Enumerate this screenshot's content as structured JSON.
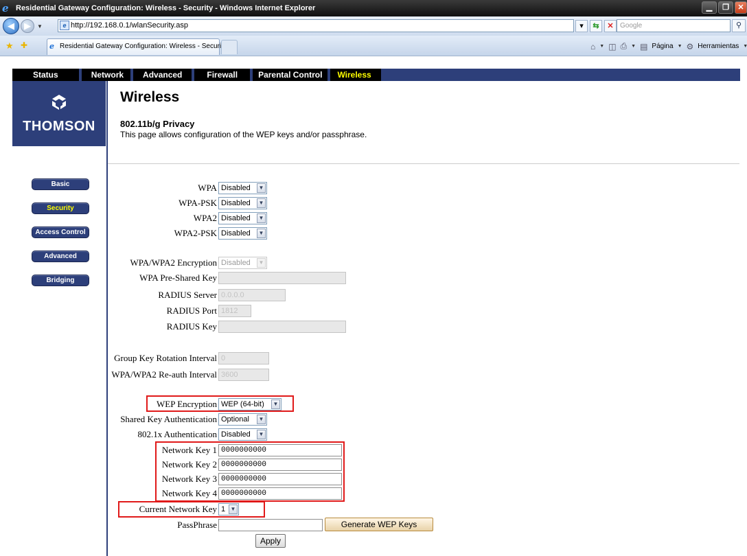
{
  "window": {
    "title": "Residential Gateway Configuration: Wireless - Security - Windows Internet Explorer"
  },
  "browser": {
    "url": "http://192.168.0.1/wlanSecurity.asp",
    "search_placeholder": "Google",
    "tab_title": "Residential Gateway Configuration: Wireless - Security",
    "page_menu": "Página",
    "tools_menu": "Herramientas"
  },
  "topnav": [
    "Status",
    "Network",
    "Advanced",
    "Firewall",
    "Parental Control",
    "Wireless"
  ],
  "logo_text": "THOMSON",
  "sidebar": [
    "Basic",
    "Security",
    "Access Control",
    "Advanced",
    "Bridging"
  ],
  "page": {
    "title": "Wireless",
    "subtitle": "802.11b/g Privacy",
    "description": "This page allows configuration of the WEP keys and/or passphrase."
  },
  "form": {
    "wpa": {
      "label": "WPA",
      "value": "Disabled"
    },
    "wpa_psk": {
      "label": "WPA-PSK",
      "value": "Disabled"
    },
    "wpa2": {
      "label": "WPA2",
      "value": "Disabled"
    },
    "wpa2_psk": {
      "label": "WPA2-PSK",
      "value": "Disabled"
    },
    "encryption": {
      "label": "WPA/WPA2 Encryption",
      "value": "Disabled"
    },
    "preshared_key": {
      "label": "WPA Pre-Shared Key",
      "value": ""
    },
    "radius_server": {
      "label": "RADIUS Server",
      "value": "0.0.0.0"
    },
    "radius_port": {
      "label": "RADIUS Port",
      "value": "1812"
    },
    "radius_key": {
      "label": "RADIUS Key",
      "value": ""
    },
    "group_key_interval": {
      "label": "Group Key Rotation Interval",
      "value": "0"
    },
    "reauth_interval": {
      "label": "WPA/WPA2 Re-auth Interval",
      "value": "3600"
    },
    "wep_encryption": {
      "label": "WEP Encryption",
      "value": "WEP (64-bit)"
    },
    "shared_key_auth": {
      "label": "Shared Key Authentication",
      "value": "Optional"
    },
    "auth_8021x": {
      "label": "802.1x Authentication",
      "value": "Disabled"
    },
    "network_key_1": {
      "label": "Network Key 1",
      "value": "0000000000"
    },
    "network_key_2": {
      "label": "Network Key 2",
      "value": "0000000000"
    },
    "network_key_3": {
      "label": "Network Key 3",
      "value": "0000000000"
    },
    "network_key_4": {
      "label": "Network Key 4",
      "value": "0000000000"
    },
    "current_key": {
      "label": "Current Network Key",
      "value": "1"
    },
    "passphrase": {
      "label": "PassPhrase",
      "value": ""
    },
    "generate_button": "Generate WEP Keys",
    "apply_button": "Apply"
  },
  "colors": {
    "brand": "#2d3f7a",
    "active_nav": "#ffff00",
    "highlight": "#e01919"
  }
}
